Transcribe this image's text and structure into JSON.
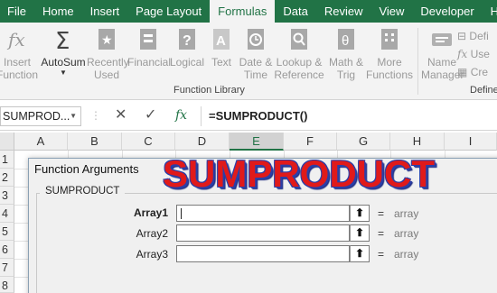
{
  "ribbon": {
    "tabs": [
      "File",
      "Home",
      "Insert",
      "Page Layout",
      "Formulas",
      "Data",
      "Review",
      "View",
      "Developer",
      "Help"
    ],
    "active_tab": "Formulas",
    "buttons": [
      {
        "line1": "Insert",
        "line2": "Function",
        "icon": "fx-icon",
        "enabled": false
      },
      {
        "line1": "AutoSum",
        "line2": "",
        "icon": "sigma-icon",
        "enabled": true
      },
      {
        "line1": "Recently",
        "line2": "Used",
        "icon": "star-book-icon",
        "enabled": false
      },
      {
        "line1": "Financial",
        "line2": "",
        "icon": "financial-icon",
        "enabled": false
      },
      {
        "line1": "Logical",
        "line2": "",
        "icon": "question-book-icon",
        "enabled": false
      },
      {
        "line1": "Text",
        "line2": "",
        "icon": "text-book-icon",
        "enabled": false
      },
      {
        "line1": "Date &",
        "line2": "Time",
        "icon": "clock-book-icon",
        "enabled": false
      },
      {
        "line1": "Lookup &",
        "line2": "Reference",
        "icon": "lookup-book-icon",
        "enabled": false
      },
      {
        "line1": "Math &",
        "line2": "Trig",
        "icon": "theta-book-icon",
        "enabled": false
      },
      {
        "line1": "More",
        "line2": "Functions",
        "icon": "more-book-icon",
        "enabled": false
      },
      {
        "line1": "Name",
        "line2": "Manager",
        "icon": "name-manager-icon",
        "enabled": false
      }
    ],
    "group_function_library": "Function Library",
    "group_defined_names": "Define",
    "side_items": [
      "Defi",
      "Use",
      "Cre"
    ]
  },
  "formula_bar": {
    "name_box": "SUMPROD...",
    "formula": "=SUMPRODUCT()"
  },
  "grid": {
    "columns": [
      "A",
      "B",
      "C",
      "D",
      "E",
      "F",
      "G",
      "H",
      "I"
    ],
    "selected_column": "E",
    "rows": [
      "1",
      "2",
      "3",
      "4",
      "5",
      "6",
      "7",
      "8"
    ]
  },
  "dialog": {
    "title": "Function Arguments",
    "function_name": "SUMPRODUCT",
    "args": [
      {
        "label": "Array1",
        "value": "",
        "result": "array"
      },
      {
        "label": "Array2",
        "value": "",
        "result": "array"
      },
      {
        "label": "Array3",
        "value": "",
        "result": "array"
      }
    ],
    "equals": "="
  },
  "overlay_title": "SUMPRODUCT",
  "colors": {
    "accent": "#217346",
    "overlay_fill": "#e01a1a",
    "overlay_outline": "#2a3ea8"
  }
}
